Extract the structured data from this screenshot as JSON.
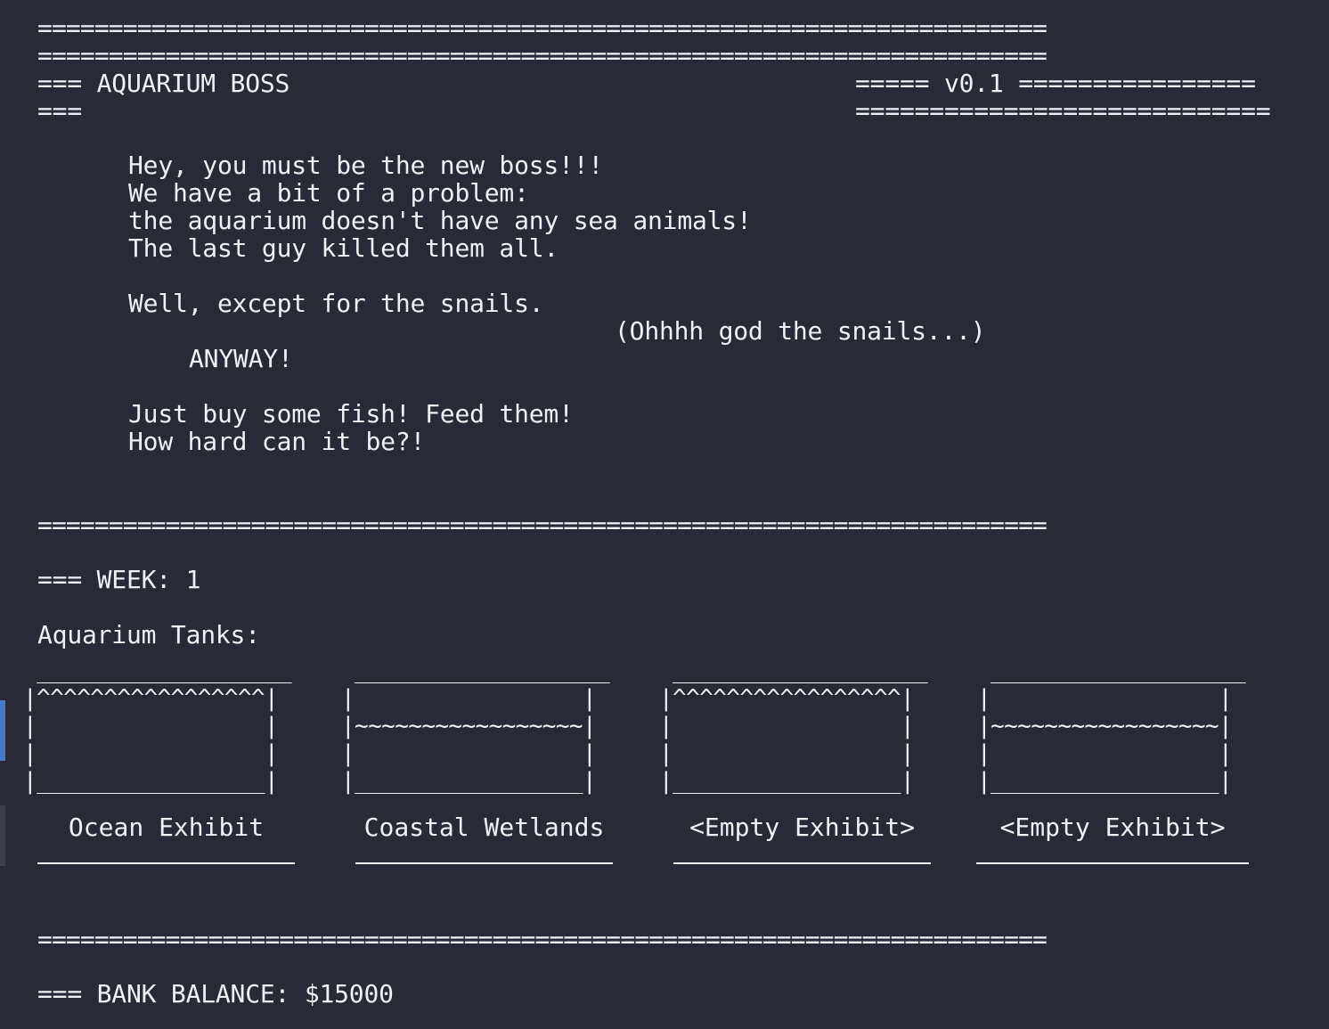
{
  "app": {
    "title_line": "=== AQUARIUM BOSS",
    "title_line_2": "===",
    "version_line": "===== v0.1 ================",
    "version_line_2": "============================"
  },
  "rules": {
    "top1": "=======================================================================",
    "top2": "=======================================================================",
    "mid": "=======================================================================",
    "bottom": "======================================================================="
  },
  "intro": {
    "line1": "Hey, you must be the new boss!!!",
    "line2": "We have a bit of a problem:",
    "line3": "the aquarium doesn't have any sea animals!",
    "line4": "The last guy killed them all.",
    "line5": "Well, except for the snails.",
    "line6": "(Ohhhh god the snails...)",
    "line7": "ANYWAY!",
    "line8": "Just buy some fish! Feed them!",
    "line9": "How hard can it be?!"
  },
  "status": {
    "week_line": "=== WEEK: 1",
    "tanks_heading": "Aquarium Tanks:",
    "bank_line": "=== BANK BALANCE: $15000"
  },
  "tanks": [
    {
      "art": " ___________________\n|^^^^^^^^^^^^^^^^^|\n|                 |\n|                 |\n|_________________|",
      "label": "Ocean Exhibit"
    },
    {
      "art": " ___________________\n|                 |\n|~~~~~~~~~~~~~~~~~|\n|                 |\n|_________________|",
      "label": "Coastal Wetlands"
    },
    {
      "art": " ___________________\n|^^^^^^^^^^^^^^^^^|\n|                 |\n|                 |\n|_________________|",
      "label": "<Empty Exhibit>"
    },
    {
      "art": " ___________________\n|                 |\n|~~~~~~~~~~~~~~~~~|\n|                 |\n|_________________|",
      "label": "<Empty Exhibit>"
    }
  ],
  "colors": {
    "background": "#282b37",
    "text": "#eef0f4",
    "edge_accent": "#4a78c9"
  }
}
